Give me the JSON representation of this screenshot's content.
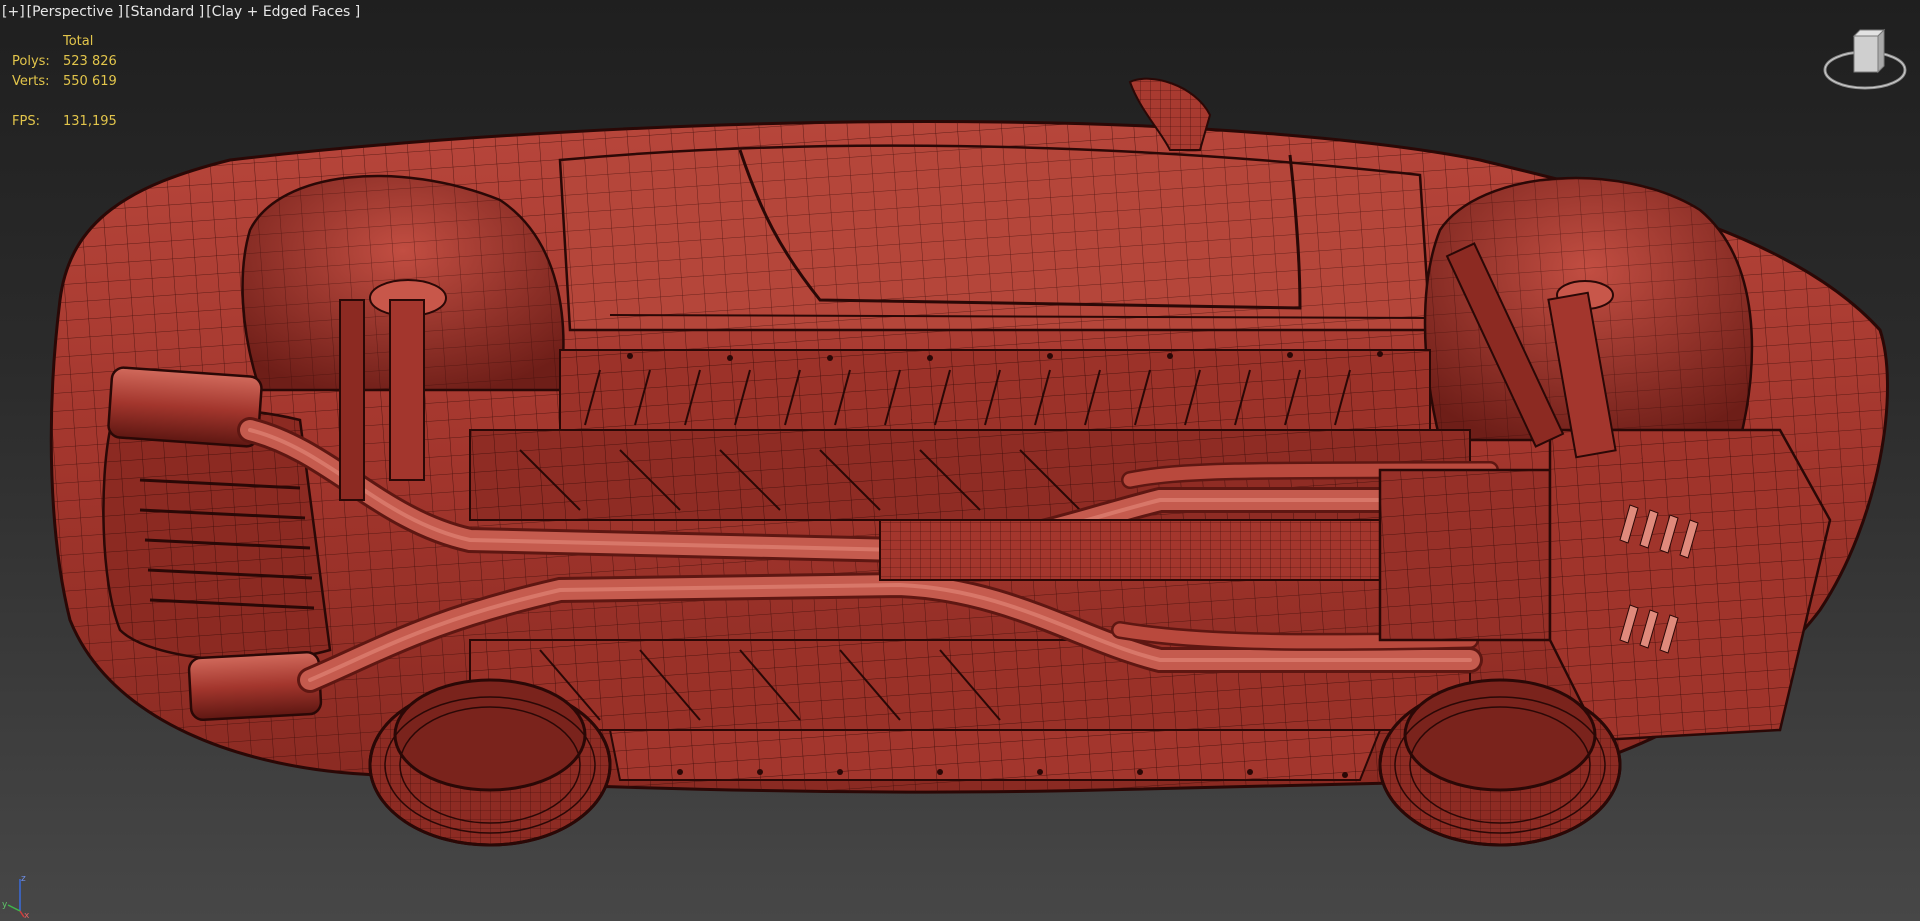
{
  "viewport": {
    "plus": "[+]",
    "view": "[Perspective ]",
    "shading_standard": "[Standard ]",
    "shading_mode": "[Clay + Edged Faces ]"
  },
  "stats": {
    "header": "Total",
    "polys_label": "Polys:",
    "polys_value": "523 826",
    "verts_label": "Verts:",
    "verts_value": "550 619",
    "fps_label": "FPS:",
    "fps_value": "131,195"
  },
  "viewcube": {
    "icon": "viewcube-icon"
  },
  "axis_gizmo": {
    "icon": "axis-tripod-icon",
    "x": "x",
    "y": "y",
    "z": "z"
  },
  "model": {
    "icon": "car-underbody-mesh"
  },
  "colors": {
    "background_top": "#1f1f1f",
    "background_bottom": "#474747",
    "mesh": "#a8382f",
    "mesh_dark": "#6e1e18",
    "wire": "#2a0806",
    "label_text": "#e6e6e6",
    "stats_text": "#e2c54b"
  }
}
